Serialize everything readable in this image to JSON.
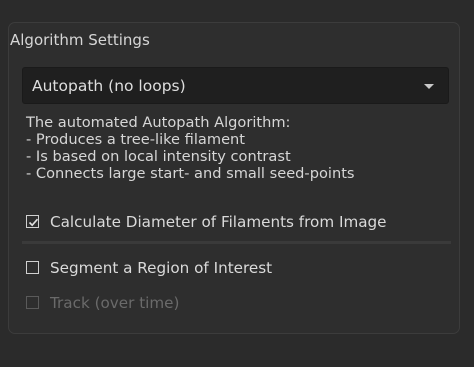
{
  "group": {
    "title": "Algorithm Settings"
  },
  "algorithm_select": {
    "value": "Autopath (no loops)"
  },
  "description": {
    "lines": [
      "The automated Autopath Algorithm:",
      "- Produces a tree-like filament",
      "- Is based on local intensity contrast",
      "- Connects large start- and small seed-points"
    ]
  },
  "options": {
    "calc_diameter": {
      "label": "Calculate Diameter of Filaments from Image",
      "checked": true,
      "enabled": true
    },
    "segment_roi": {
      "label": "Segment a Region of Interest",
      "checked": false,
      "enabled": true
    },
    "track": {
      "label": "Track (over time)",
      "checked": false,
      "enabled": false
    }
  },
  "icons": {
    "dropdown": "chevron-down-icon",
    "check": "checkmark-icon"
  },
  "colors": {
    "background": "#2b2b2b",
    "dropdown_bg": "#1f1f1f",
    "text": "#d8d8d8",
    "disabled_text": "#6a6a6a"
  }
}
